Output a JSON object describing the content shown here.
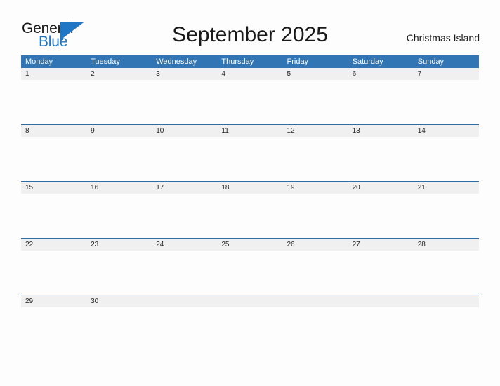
{
  "brand": {
    "name_part1": "General",
    "name_part2": "Blue",
    "accent_color": "#1F76C4"
  },
  "header": {
    "title": "September 2025",
    "location": "Christmas Island"
  },
  "calendar": {
    "header_bg": "#3275B5",
    "row_bg": "#F0F0F0",
    "rule_color": "#2E6DA8",
    "weekdays": [
      "Monday",
      "Tuesday",
      "Wednesday",
      "Thursday",
      "Friday",
      "Saturday",
      "Sunday"
    ],
    "weeks": [
      {
        "days": [
          "1",
          "2",
          "3",
          "4",
          "5",
          "6",
          "7"
        ]
      },
      {
        "days": [
          "8",
          "9",
          "10",
          "11",
          "12",
          "13",
          "14"
        ]
      },
      {
        "days": [
          "15",
          "16",
          "17",
          "18",
          "19",
          "20",
          "21"
        ]
      },
      {
        "days": [
          "22",
          "23",
          "24",
          "25",
          "26",
          "27",
          "28"
        ]
      },
      {
        "days": [
          "29",
          "30",
          "",
          "",
          "",
          "",
          ""
        ]
      }
    ]
  }
}
